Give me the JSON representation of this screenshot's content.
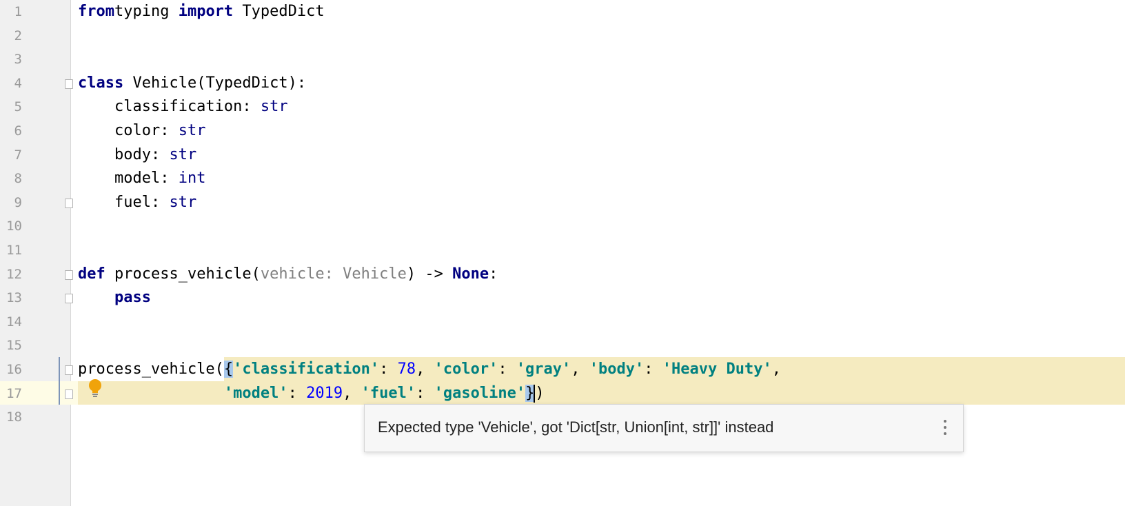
{
  "editor": {
    "line_numbers": [
      "1",
      "2",
      "3",
      "4",
      "5",
      "6",
      "7",
      "8",
      "9",
      "10",
      "11",
      "12",
      "13",
      "14",
      "15",
      "16",
      "17",
      "18"
    ],
    "lines": {
      "l1": [
        [
          "kw",
          "from"
        ],
        [
          "",
          "typing "
        ],
        [
          "kw",
          "import"
        ],
        [
          "",
          " TypedDict"
        ]
      ],
      "l4": [
        [
          "kw",
          "class"
        ],
        [
          "",
          " Vehicle(TypedDict):"
        ]
      ],
      "l5": [
        [
          "",
          "    classification: "
        ],
        [
          "ty",
          "str"
        ]
      ],
      "l6": [
        [
          "",
          "    color: "
        ],
        [
          "ty",
          "str"
        ]
      ],
      "l7": [
        [
          "",
          "    body: "
        ],
        [
          "ty",
          "str"
        ]
      ],
      "l8": [
        [
          "",
          "    model: "
        ],
        [
          "ty",
          "int"
        ]
      ],
      "l9": [
        [
          "",
          "    fuel: "
        ],
        [
          "ty",
          "str"
        ]
      ],
      "l12": [
        [
          "kw",
          "def"
        ],
        [
          "",
          " process_vehicle("
        ],
        [
          "pa",
          "vehicle: Vehicle"
        ],
        [
          "",
          ") -> "
        ],
        [
          "kw",
          "None"
        ],
        [
          "",
          ":"
        ]
      ],
      "l13": [
        [
          "",
          "    "
        ],
        [
          "kw",
          "pass"
        ]
      ],
      "l16": [
        [
          "",
          "process_vehicle("
        ],
        [
          "brace",
          "{"
        ],
        [
          "st",
          "'classification'"
        ],
        [
          "",
          ": "
        ],
        [
          "nu",
          "78"
        ],
        [
          "",
          ", "
        ],
        [
          "st",
          "'color'"
        ],
        [
          "",
          ": "
        ],
        [
          "st",
          "'gray'"
        ],
        [
          "",
          ", "
        ],
        [
          "st",
          "'body'"
        ],
        [
          "",
          ": "
        ],
        [
          "st",
          "'Heavy Duty'"
        ],
        [
          "",
          ","
        ]
      ],
      "l17": [
        [
          "",
          "                "
        ],
        [
          "st",
          "'model'"
        ],
        [
          "",
          ": "
        ],
        [
          "nu",
          "2019"
        ],
        [
          "",
          ", "
        ],
        [
          "st",
          "'fuel'"
        ],
        [
          "",
          ": "
        ],
        [
          "st",
          "'gasoline'"
        ],
        [
          "brace",
          "}"
        ],
        [
          "caret",
          ""
        ],
        [
          "",
          ")"
        ]
      ]
    }
  },
  "tooltip": {
    "message": "Expected type 'Vehicle', got 'Dict[str, Union[int, str]]' instead",
    "more_icon": "kebab-vertical-icon"
  },
  "intention_icon": "lightbulb-icon",
  "colors": {
    "keyword": "#000080",
    "string": "#008080",
    "number": "#0000ff",
    "highlight": "#f5ebc0"
  }
}
